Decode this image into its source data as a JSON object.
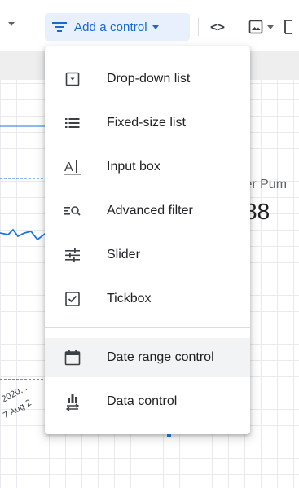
{
  "toolbar": {
    "add_control_label": "Add a control",
    "code_symbol": "<>"
  },
  "menu": {
    "items": [
      {
        "label": "Drop-down list",
        "icon": "dropdown-list-icon"
      },
      {
        "label": "Fixed-size list",
        "icon": "fixed-list-icon"
      },
      {
        "label": "Input box",
        "icon": "input-box-icon"
      },
      {
        "label": "Advanced filter",
        "icon": "advanced-filter-icon"
      },
      {
        "label": "Slider",
        "icon": "slider-icon"
      },
      {
        "label": "Tickbox",
        "icon": "checkbox-icon"
      },
      {
        "label": "Date range control",
        "icon": "calendar-icon"
      },
      {
        "label": "Data control",
        "icon": "data-control-icon"
      }
    ]
  },
  "background": {
    "scorecard_label": "ter Pum",
    "scorecard_value": "88",
    "axis_label_1": "2020,..",
    "axis_label_2": "7 Aug 2"
  },
  "colors": {
    "accent": "#1967d2",
    "accent_bg": "#e8f0fe",
    "chart_line": "#1a73e8"
  }
}
